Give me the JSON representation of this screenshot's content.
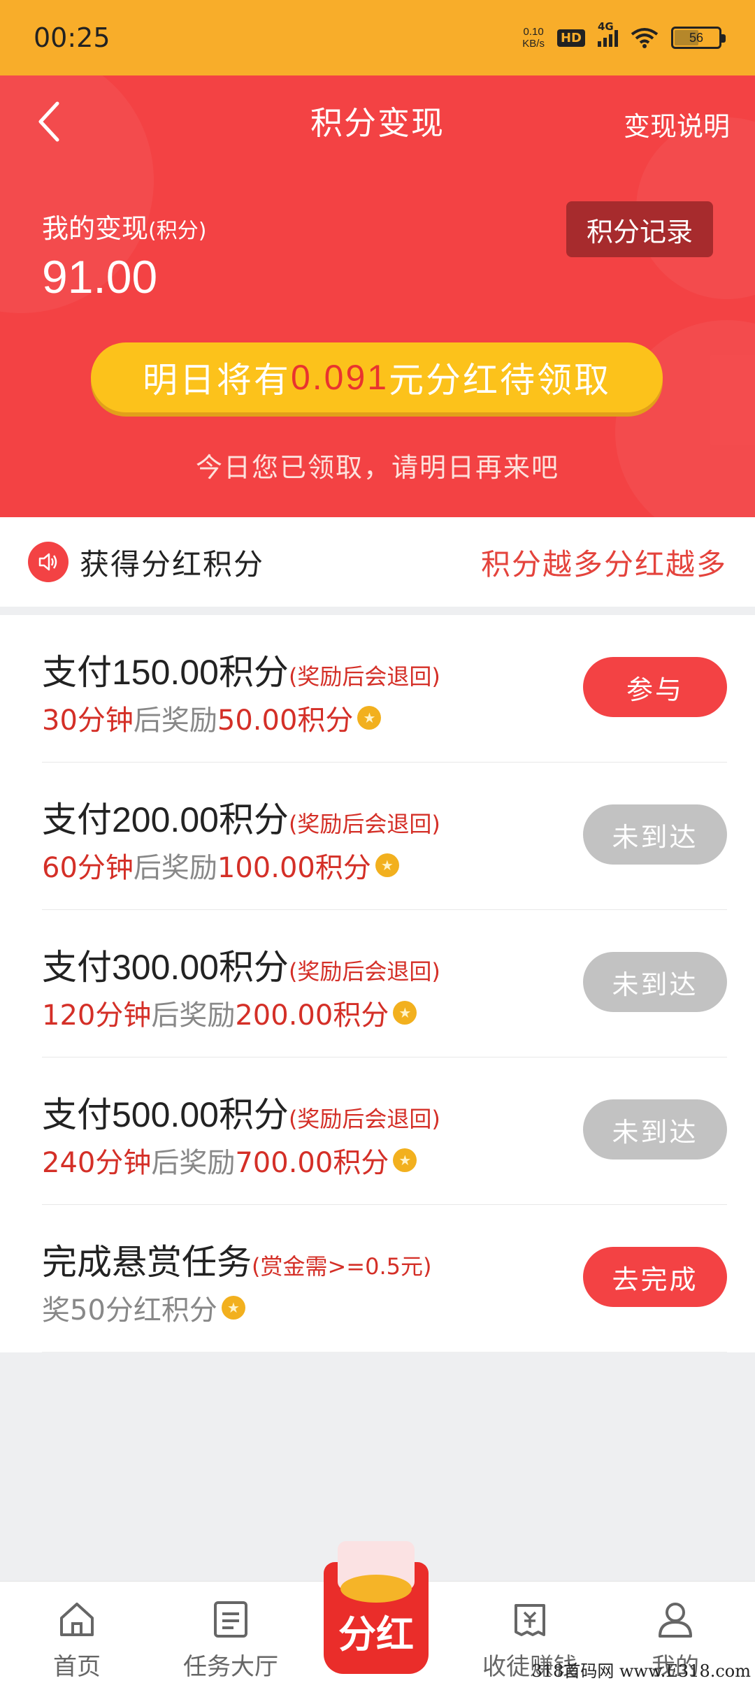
{
  "status_bar": {
    "time": "00:25",
    "speed_value": "0.10",
    "speed_unit": "KB/s",
    "hd": "HD",
    "network": "4G",
    "battery": "56",
    "battery_level": 0.56
  },
  "header": {
    "title": "积分变现",
    "help_link": "变现说明",
    "my_label": "我的变现",
    "my_label_unit": "(积分)",
    "my_value": "91.00",
    "record_button": "积分记录",
    "bonus_prefix": "明日将有",
    "bonus_amount": "0.091",
    "bonus_suffix": "元分红待领取",
    "today_note": "今日您已领取，请明日再来吧"
  },
  "section": {
    "title": "获得分红积分",
    "slogan": "积分越多分红越多"
  },
  "tasks": [
    {
      "title_prefix": "支付",
      "title_amount": "150.00",
      "title_suffix": "积分",
      "note": "(奖励后会退回)",
      "time": "30分钟",
      "mid": "后奖励",
      "reward": "50.00积分",
      "button": "参与",
      "status": "active"
    },
    {
      "title_prefix": "支付",
      "title_amount": "200.00",
      "title_suffix": "积分",
      "note": "(奖励后会退回)",
      "time": "60分钟",
      "mid": "后奖励",
      "reward": "100.00积分",
      "button": "未到达",
      "status": "disabled"
    },
    {
      "title_prefix": "支付",
      "title_amount": "300.00",
      "title_suffix": "积分",
      "note": "(奖励后会退回)",
      "time": "120分钟",
      "mid": "后奖励",
      "reward": "200.00积分",
      "button": "未到达",
      "status": "disabled"
    },
    {
      "title_prefix": "支付",
      "title_amount": "500.00",
      "title_suffix": "积分",
      "note": "(奖励后会退回)",
      "time": "240分钟",
      "mid": "后奖励",
      "reward": "700.00积分",
      "button": "未到达",
      "status": "disabled"
    },
    {
      "title_text": "完成悬赏任务",
      "note": "(赏金需>=0.5元)",
      "sub_text": "奖50分红积分",
      "button": "去完成",
      "status": "active"
    }
  ],
  "tabbar": {
    "items": [
      {
        "label": "首页",
        "icon": "home-icon"
      },
      {
        "label": "任务大厅",
        "icon": "list-icon"
      },
      {
        "label": "分红",
        "icon": "red-envelope-icon"
      },
      {
        "label": "收徒赚钱",
        "icon": "wallet-icon"
      },
      {
        "label": "我的",
        "icon": "person-icon"
      }
    ]
  },
  "watermark": "318首码网 www.E318.com",
  "colors": {
    "status_bar": "#f8ad2a",
    "header_red": "#f34244",
    "pill_yellow": "#fcc21b",
    "accent_red": "#d42f27",
    "disabled_grey": "#c2c2c2"
  }
}
